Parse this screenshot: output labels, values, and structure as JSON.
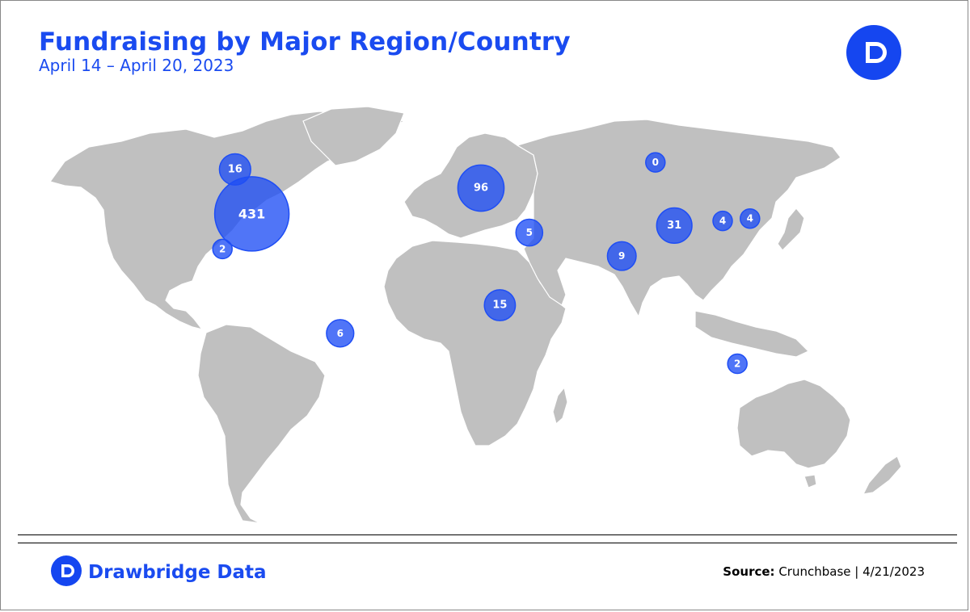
{
  "header": {
    "title": "Fundraising by Major Region/Country",
    "subtitle": "April 14 – April 20, 2023"
  },
  "colors": {
    "accent": "#1a4bf0",
    "bubble": "#1f4ef5",
    "land": "#c0c0c0"
  },
  "logo": {
    "icon": "drawbridge-logo-icon"
  },
  "chart_data": {
    "type": "bubble-map",
    "title": "Fundraising by Major Region/Country",
    "subtitle": "April 14 – April 20, 2023",
    "points": [
      {
        "label": "431",
        "value": 431,
        "lat": 39,
        "lon": -97
      },
      {
        "label": "16",
        "value": 16,
        "lat": 58,
        "lon": -105
      },
      {
        "label": "2",
        "value": 2,
        "lat": 24,
        "lon": -111
      },
      {
        "label": "6",
        "value": 6,
        "lat": -12,
        "lon": -55
      },
      {
        "label": "96",
        "value": 96,
        "lat": 50,
        "lon": 12
      },
      {
        "label": "5",
        "value": 5,
        "lat": 31,
        "lon": 35
      },
      {
        "label": "15",
        "value": 15,
        "lat": 0,
        "lon": 21
      },
      {
        "label": "0",
        "value": 0,
        "lat": 61,
        "lon": 95
      },
      {
        "label": "9",
        "value": 9,
        "lat": 21,
        "lon": 79
      },
      {
        "label": "31",
        "value": 31,
        "lat": 34,
        "lon": 104
      },
      {
        "label": "4",
        "value": 4,
        "lat": 36,
        "lon": 127
      },
      {
        "label": "4",
        "value": 4,
        "lat": 37,
        "lon": 140
      },
      {
        "label": "2",
        "value": 2,
        "lat": -25,
        "lon": 134
      }
    ]
  },
  "footer": {
    "brand": "Drawbridge Data",
    "source_label": "Source:",
    "source_text": "Crunchbase | 4/21/2023"
  }
}
